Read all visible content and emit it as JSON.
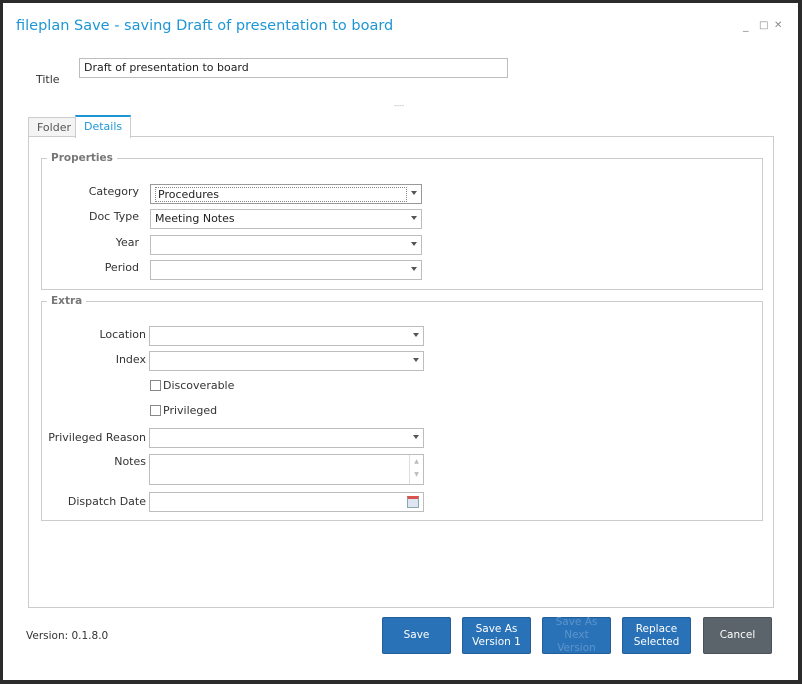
{
  "window": {
    "title": "fileplan Save - saving Draft of presentation to board",
    "minimize": "_",
    "maximize": "□",
    "close": "✕"
  },
  "title_field": {
    "label": "Title",
    "value": "Draft of presentation to board"
  },
  "splitter": "----",
  "tabs": [
    {
      "label": "Folder",
      "active": false
    },
    {
      "label": "Details",
      "active": true
    }
  ],
  "properties": {
    "legend": "Properties",
    "fields": [
      {
        "label": "Category",
        "value": "Procedures"
      },
      {
        "label": "Doc Type",
        "value": "Meeting Notes"
      },
      {
        "label": "Year",
        "value": ""
      },
      {
        "label": "Period",
        "value": ""
      }
    ]
  },
  "extra": {
    "legend": "Extra",
    "location": {
      "label": "Location",
      "value": ""
    },
    "index": {
      "label": "Index",
      "value": ""
    },
    "discoverable": {
      "label": "Discoverable",
      "checked": false
    },
    "privileged": {
      "label": "Privileged",
      "checked": false
    },
    "privileged_reason": {
      "label": "Privileged Reason",
      "value": ""
    },
    "notes": {
      "label": "Notes",
      "value": ""
    },
    "dispatch_date": {
      "label": "Dispatch Date",
      "value": ""
    }
  },
  "version": "Version: 0.1.8.0",
  "buttons": {
    "save": "Save",
    "save_as_version": "Save As Version 1",
    "save_as_next": "Save As Next Version",
    "replace": "Replace Selected",
    "cancel": "Cancel"
  },
  "colors": {
    "accent": "#1e96d6",
    "button": "#2a72b8",
    "cancel": "#5b646a"
  }
}
